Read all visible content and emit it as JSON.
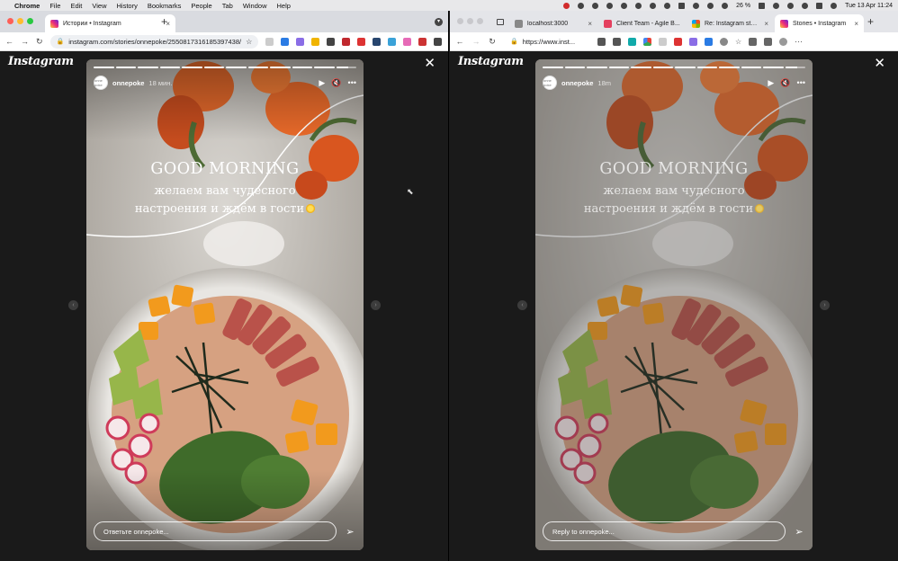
{
  "menubar": {
    "apple": "",
    "app": "Chrome",
    "items": [
      "File",
      "Edit",
      "View",
      "History",
      "Bookmarks",
      "People",
      "Tab",
      "Window",
      "Help"
    ],
    "battery": "26 %",
    "datetime": "Tue 13 Apr  11:24"
  },
  "left": {
    "tab": {
      "title": "Истории • Instagram",
      "icon": "instagram-favicon"
    },
    "url": "instagram.com/stories/onnepoke/2550817316185397438/",
    "story": {
      "username": "onnepoke",
      "time": "18 мин.",
      "headline": "GOOD MORNING",
      "line1": "желаем вам чудесного",
      "line2": "настроения и ждём в гости",
      "reply_placeholder": "Ответьте onnepoke...",
      "progress": [
        1,
        1,
        1,
        1,
        1,
        1,
        1,
        1,
        1,
        1,
        1,
        0.6
      ]
    }
  },
  "right": {
    "tabs": [
      {
        "title": "localhost:3000",
        "icon": "page-favicon"
      },
      {
        "title": "Client Team - Agile B...",
        "icon": "pinterest-favicon"
      },
      {
        "title": "Re: Instagram stories",
        "icon": "microsoft-favicon"
      },
      {
        "title": "Stories • Instagram",
        "icon": "instagram-favicon"
      }
    ],
    "url": "https://www.inst...",
    "story": {
      "username": "onnepoke",
      "time": "18m",
      "headline": "GOOD MORNING",
      "line1": "желаем вам чудесного",
      "line2": "настроения и ждём в гости",
      "reply_placeholder": "Reply to onnepoke...",
      "progress": [
        1,
        1,
        1,
        1,
        1,
        1,
        1,
        1,
        1,
        1,
        1,
        0.6
      ]
    }
  },
  "brand": "Instagram",
  "avatar_text": "onne poke",
  "icons": {
    "close": "close-icon",
    "play": "play-icon",
    "mute": "mute-icon",
    "more": "more-icon",
    "send": "send-icon",
    "prev": "chevron-left-icon",
    "next": "chevron-right-icon"
  },
  "colors": {
    "background": "#1a1a1a",
    "story_text": "#ffffff",
    "accent": "#ee2a7b"
  }
}
